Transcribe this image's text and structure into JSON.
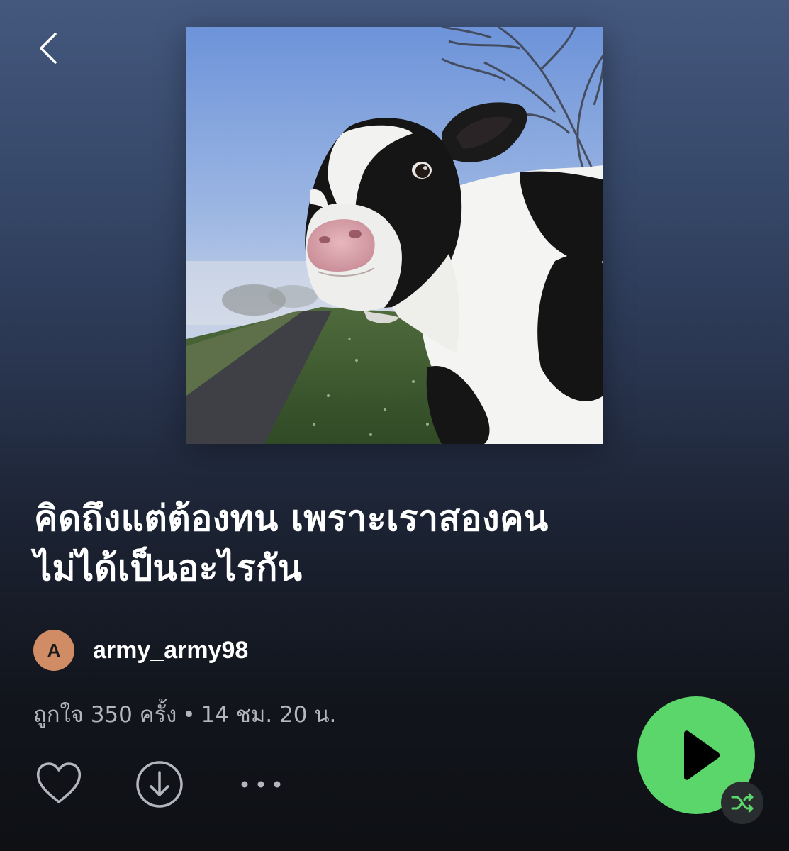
{
  "header": {
    "back_icon": "chevron-left-icon"
  },
  "playlist": {
    "cover_description_icon": "cover-art",
    "title_line1": "คิดถึงแต่ต้องทน เพราะเราสองคน",
    "title_line2": "ไม่ได้เป็นอะไรกัน",
    "owner": {
      "avatar_letter": "A",
      "avatar_color": "#d08c64",
      "name": "army_army98"
    },
    "meta": {
      "likes": "ถูกใจ 350 ครั้ง",
      "separator": "•",
      "duration": "14 ชม. 20 น."
    }
  },
  "actions": {
    "like_icon": "heart-outline-icon",
    "download_icon": "download-circle-icon",
    "more_icon": "more-horizontal-icon",
    "play_icon": "play-icon",
    "shuffle_icon": "shuffle-icon"
  },
  "colors": {
    "play_button": "#5ad66a",
    "shuffle_icon": "#5ad66a",
    "meta_text": "#b3b6bd",
    "background_top": "#44587e",
    "background_bottom": "#0e1014"
  }
}
